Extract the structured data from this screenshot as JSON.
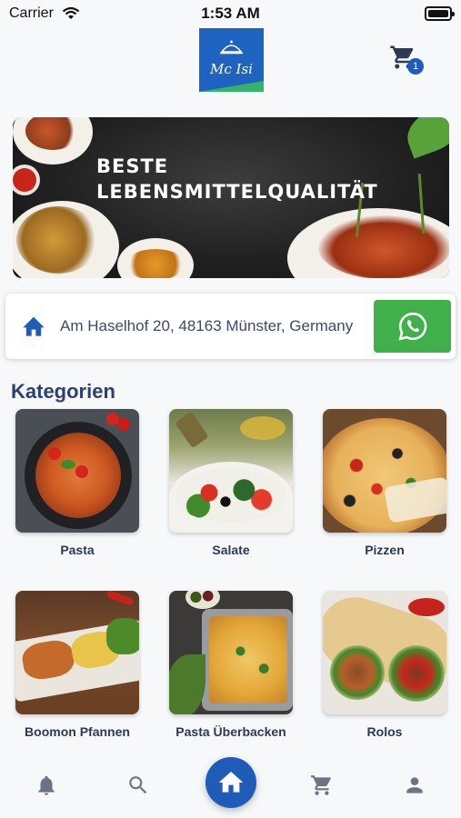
{
  "status_bar": {
    "carrier": "Carrier",
    "time": "1:53 AM"
  },
  "header": {
    "logo_text": "Mc Isi",
    "cart_count": "1"
  },
  "banner": {
    "line1": "BESTE",
    "line2": "LEBENSMITTELQUALITÄT"
  },
  "address": {
    "text": "Am Haselhof 20, 48163 Münster, Germany"
  },
  "categories_title": "Kategorien",
  "categories": [
    {
      "label": "Pasta"
    },
    {
      "label": "Salate"
    },
    {
      "label": "Pizzen"
    },
    {
      "label": "Boomon Pfannen"
    },
    {
      "label": "Pasta Überbacken"
    },
    {
      "label": "Rolos"
    }
  ],
  "nav": {
    "items": [
      "bell-icon",
      "search-icon",
      "home-icon",
      "cart-icon",
      "user-icon"
    ],
    "active": "home"
  },
  "colors": {
    "primary": "#1f5cb8",
    "whatsapp": "#3fb04a",
    "title": "#2b4170"
  }
}
